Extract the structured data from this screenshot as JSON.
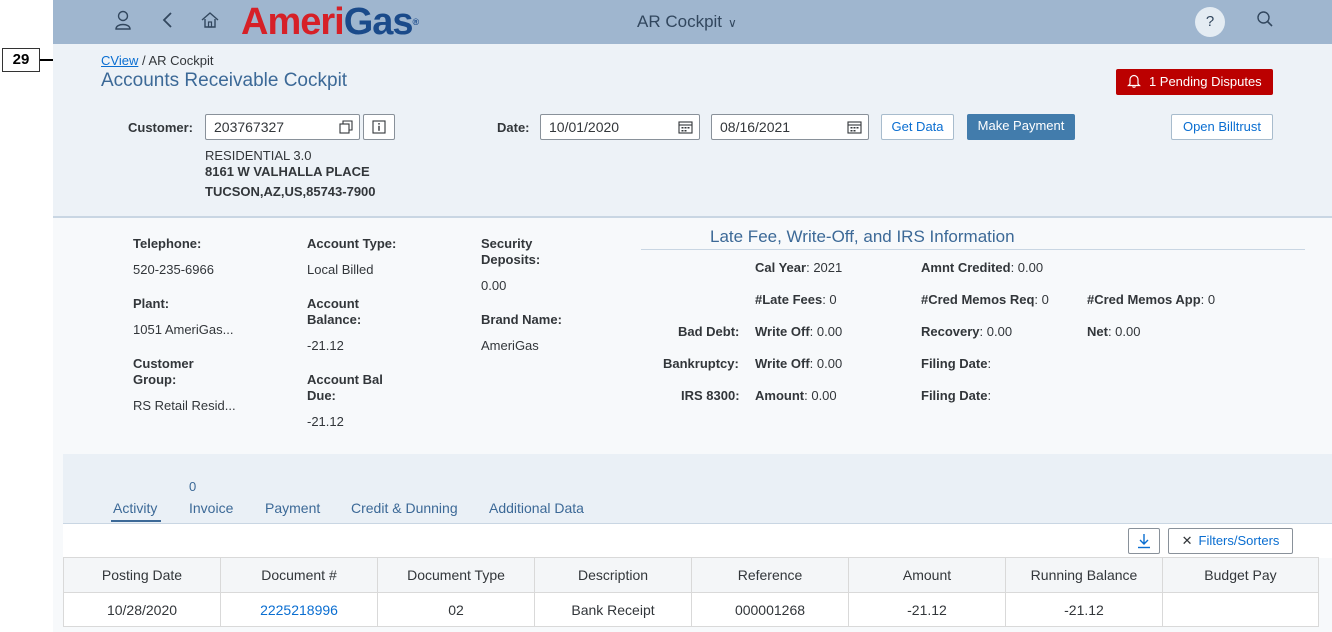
{
  "annotation": {
    "number": "29"
  },
  "shell": {
    "logo_ameri": "Ameri",
    "logo_gas": "Gas",
    "logo_reg": "®",
    "title": "AR Cockpit",
    "help": "?"
  },
  "header": {
    "breadcrumb_link": "CView",
    "breadcrumb_rest": " / AR Cockpit",
    "title": "Accounts Receivable Cockpit",
    "disputes_button": "1 Pending Disputes",
    "customer_label": "Customer:",
    "customer_value": "203767327",
    "date_label": "Date:",
    "date_from": "10/01/2020",
    "date_to": "08/16/2021",
    "get_data_button": "Get Data",
    "make_payment_button": "Make Payment",
    "open_billtrust_button": "Open Billtrust",
    "customer_line1": "RESIDENTIAL 3.0",
    "customer_line2": "8161 W VALHALLA PLACE",
    "customer_line3": "TUCSON,AZ,US,85743-7900"
  },
  "details": {
    "telephone_label": "Telephone:",
    "telephone_value": "520-235-6966",
    "plant_label": "Plant:",
    "plant_value": "1051 AmeriGas...",
    "customer_group_label_1": "Customer",
    "customer_group_label_2": "Group:",
    "customer_group_value": "RS Retail Resid...",
    "account_type_label": "Account Type:",
    "account_type_value": "Local Billed",
    "account_balance_label_1": "Account",
    "account_balance_label_2": "Balance:",
    "account_balance_value": "-21.12",
    "account_bal_due_label_1": "Account Bal",
    "account_bal_due_label_2": "Due:",
    "account_bal_due_value": "-21.12",
    "security_deposits_label_1": "Security",
    "security_deposits_label_2": "Deposits:",
    "security_deposits_value": "0.00",
    "brand_name_label": "Brand Name:",
    "brand_name_value": "AmeriGas"
  },
  "late_fee": {
    "title": "Late Fee, Write-Off, and IRS Information",
    "cal_year_label": "Cal Year",
    "cal_year_value": ": 2021",
    "amnt_credited_label": "Amnt Credited",
    "amnt_credited_value": ": 0.00",
    "late_fees_label": "#Late Fees",
    "late_fees_value": ": 0",
    "cred_memos_req_label": "#Cred Memos Req",
    "cred_memos_req_value": ": 0",
    "cred_memos_app_label": "#Cred Memos App",
    "cred_memos_app_value": ": 0",
    "bad_debt_label": "Bad Debt:",
    "bad_debt_writeoff_label": "Write Off",
    "bad_debt_writeoff_value": ": 0.00",
    "recovery_label": "Recovery",
    "recovery_value": ": 0.00",
    "net_label": "Net",
    "net_value": ": 0.00",
    "bankruptcy_label": "Bankruptcy:",
    "bankruptcy_writeoff_label": "Write Off",
    "bankruptcy_writeoff_value": ": 0.00",
    "filing_date_label_1": "Filing Date",
    "filing_date_value_1": ":",
    "irs_label": "IRS 8300:",
    "irs_amount_label": "Amount",
    "irs_amount_value": ": 0.00",
    "filing_date_label_2": "Filing Date",
    "filing_date_value_2": ":"
  },
  "tabs": {
    "activity": "Activity",
    "invoice": "Invoice",
    "invoice_count": "0",
    "payment": "Payment",
    "credit_dunning": "Credit & Dunning",
    "additional_data": "Additional Data"
  },
  "toolbar": {
    "filters_sorters": "Filters/Sorters"
  },
  "table": {
    "columns": [
      "Posting Date",
      "Document #",
      "Document Type",
      "Description",
      "Reference",
      "Amount",
      "Running Balance",
      "Budget Pay"
    ],
    "rows": [
      [
        "10/28/2020",
        "2225218996",
        "02",
        "Bank Receipt",
        "000001268",
        "-21.12",
        "-21.12",
        ""
      ]
    ]
  }
}
